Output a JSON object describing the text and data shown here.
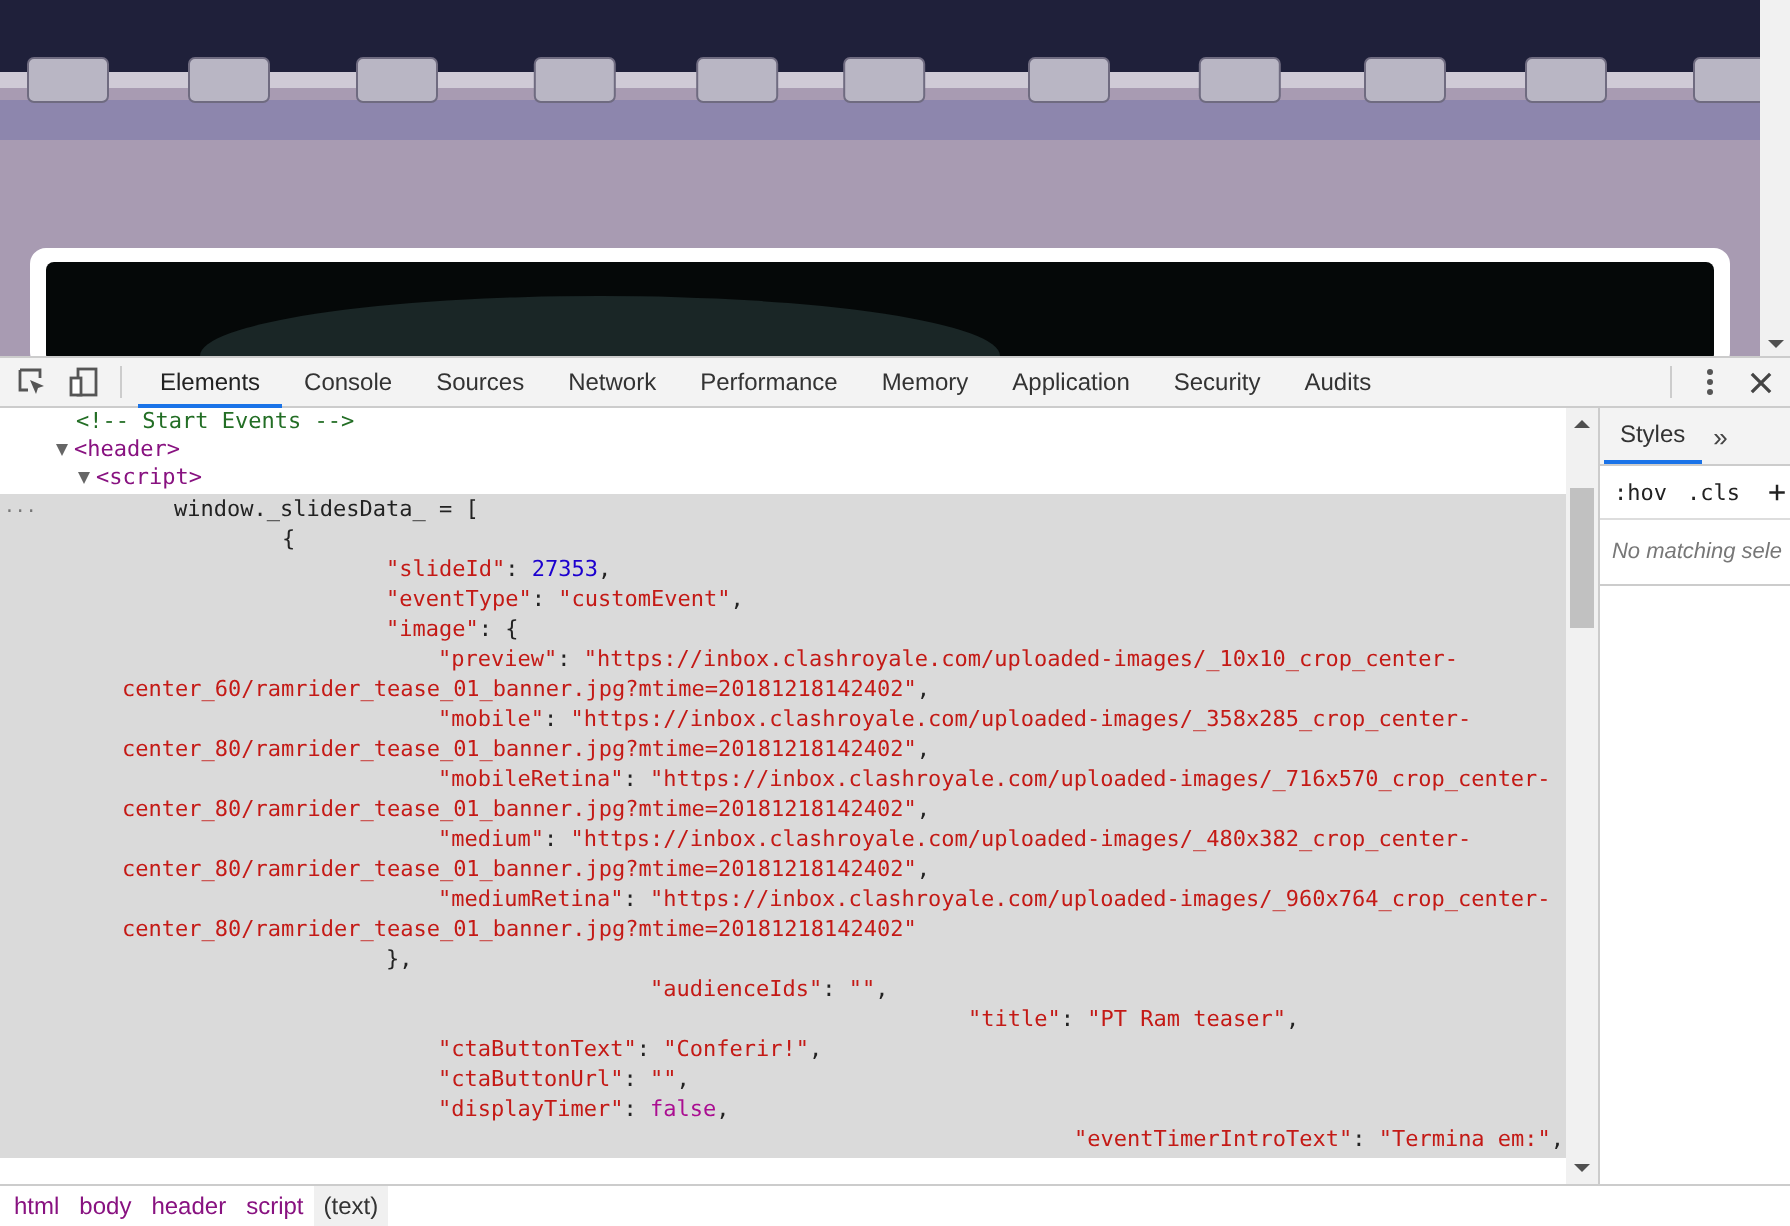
{
  "toolbar": {
    "tabs": [
      {
        "label": "Elements",
        "selected": true
      },
      {
        "label": "Console",
        "selected": false
      },
      {
        "label": "Sources",
        "selected": false
      },
      {
        "label": "Network",
        "selected": false
      },
      {
        "label": "Performance",
        "selected": false
      },
      {
        "label": "Memory",
        "selected": false
      },
      {
        "label": "Application",
        "selected": false
      },
      {
        "label": "Security",
        "selected": false
      },
      {
        "label": "Audits",
        "selected": false
      }
    ]
  },
  "elements": {
    "tree": [
      {
        "kind": "comment",
        "text": "<!-- Start Events -->"
      },
      {
        "kind": "tag",
        "text": "<header>",
        "expanded": true,
        "children": [
          {
            "kind": "tag",
            "text": "<script>",
            "expanded": true
          }
        ]
      }
    ],
    "text_node": {
      "selected": true,
      "gutter": "...",
      "lines": [
        {
          "tokens": [
            {
              "kind": "plain",
              "text": "window._slidesData_ = ["
            }
          ]
        },
        {
          "tokens": [
            {
              "kind": "plain",
              "text": "{"
            }
          ]
        },
        {
          "tokens": [
            {
              "kind": "string",
              "text": "\"slideId\""
            },
            {
              "kind": "plain",
              "text": ": "
            },
            {
              "kind": "number",
              "text": "27353"
            },
            {
              "kind": "plain",
              "text": ","
            }
          ]
        },
        {
          "tokens": [
            {
              "kind": "string",
              "text": "\"eventType\""
            },
            {
              "kind": "plain",
              "text": ": "
            },
            {
              "kind": "string",
              "text": "\"customEvent\""
            },
            {
              "kind": "plain",
              "text": ","
            }
          ]
        },
        {
          "tokens": [
            {
              "kind": "string",
              "text": "\"image\""
            },
            {
              "kind": "plain",
              "text": ": {"
            }
          ]
        },
        {
          "tokens": [
            {
              "kind": "string",
              "text": "\"preview\""
            },
            {
              "kind": "plain",
              "text": ": "
            },
            {
              "kind": "string",
              "text": "\"https://inbox.clashroyale.com/uploaded-images/_10x10_crop_center-"
            }
          ]
        },
        {
          "tokens": [
            {
              "kind": "string",
              "text": "center_60/ramrider_tease_01_banner.jpg?mtime=20181218142402\""
            },
            {
              "kind": "plain",
              "text": ","
            }
          ]
        },
        {
          "tokens": [
            {
              "kind": "string",
              "text": "\"mobile\""
            },
            {
              "kind": "plain",
              "text": ": "
            },
            {
              "kind": "string",
              "text": "\"https://inbox.clashroyale.com/uploaded-images/_358x285_crop_center-"
            }
          ]
        },
        {
          "tokens": [
            {
              "kind": "string",
              "text": "center_80/ramrider_tease_01_banner.jpg?mtime=20181218142402\""
            },
            {
              "kind": "plain",
              "text": ","
            }
          ]
        },
        {
          "tokens": [
            {
              "kind": "string",
              "text": "\"mobileRetina\""
            },
            {
              "kind": "plain",
              "text": ": "
            },
            {
              "kind": "string",
              "text": "\"https://inbox.clashroyale.com/uploaded-images/_716x570_crop_center-"
            }
          ]
        },
        {
          "tokens": [
            {
              "kind": "string",
              "text": "center_80/ramrider_tease_01_banner.jpg?mtime=20181218142402\""
            },
            {
              "kind": "plain",
              "text": ","
            }
          ]
        },
        {
          "tokens": [
            {
              "kind": "string",
              "text": "\"medium\""
            },
            {
              "kind": "plain",
              "text": ": "
            },
            {
              "kind": "string",
              "text": "\"https://inbox.clashroyale.com/uploaded-images/_480x382_crop_center-"
            }
          ]
        },
        {
          "tokens": [
            {
              "kind": "string",
              "text": "center_80/ramrider_tease_01_banner.jpg?mtime=20181218142402\""
            },
            {
              "kind": "plain",
              "text": ","
            }
          ]
        },
        {
          "tokens": [
            {
              "kind": "string",
              "text": "\"mediumRetina\""
            },
            {
              "kind": "plain",
              "text": ": "
            },
            {
              "kind": "string",
              "text": "\"https://inbox.clashroyale.com/uploaded-images/_960x764_crop_center-"
            }
          ]
        },
        {
          "tokens": [
            {
              "kind": "string",
              "text": "center_80/ramrider_tease_01_banner.jpg?mtime=20181218142402\""
            }
          ]
        },
        {
          "tokens": [
            {
              "kind": "plain",
              "text": "},"
            }
          ]
        },
        {
          "tokens": [
            {
              "kind": "string",
              "text": "\"audienceIds\""
            },
            {
              "kind": "plain",
              "text": ": "
            },
            {
              "kind": "string",
              "text": "\"\""
            },
            {
              "kind": "plain",
              "text": ","
            }
          ]
        },
        {
          "tokens": [
            {
              "kind": "string",
              "text": "\"title\""
            },
            {
              "kind": "plain",
              "text": ": "
            },
            {
              "kind": "string",
              "text": "\"PT Ram teaser\""
            },
            {
              "kind": "plain",
              "text": ","
            }
          ]
        },
        {
          "tokens": [
            {
              "kind": "string",
              "text": "\"ctaButtonText\""
            },
            {
              "kind": "plain",
              "text": ": "
            },
            {
              "kind": "string",
              "text": "\"Conferir!\""
            },
            {
              "kind": "plain",
              "text": ","
            }
          ]
        },
        {
          "tokens": [
            {
              "kind": "string",
              "text": "\"ctaButtonUrl\""
            },
            {
              "kind": "plain",
              "text": ": "
            },
            {
              "kind": "string",
              "text": "\"\""
            },
            {
              "kind": "plain",
              "text": ","
            }
          ]
        },
        {
          "tokens": [
            {
              "kind": "string",
              "text": "\"displayTimer\""
            },
            {
              "kind": "plain",
              "text": ": "
            },
            {
              "kind": "keyword",
              "text": "false"
            },
            {
              "kind": "plain",
              "text": ","
            }
          ]
        },
        {
          "tokens": [
            {
              "kind": "string",
              "text": "\"eventTimerIntroText\""
            },
            {
              "kind": "plain",
              "text": ": "
            },
            {
              "kind": "string",
              "text": "\"Termina em:\""
            },
            {
              "kind": "plain",
              "text": ","
            }
          ]
        }
      ]
    }
  },
  "breadcrumbs": [
    {
      "label": "html",
      "selected": false
    },
    {
      "label": "body",
      "selected": false
    },
    {
      "label": "header",
      "selected": false
    },
    {
      "label": "script",
      "selected": false
    },
    {
      "label": "(text)",
      "selected": true
    }
  ],
  "styles_pane": {
    "tabs": [
      {
        "label": "Styles",
        "selected": true
      }
    ],
    "more_tabs": "»",
    "hov": ":hov",
    "cls": ".cls",
    "add": "+",
    "message": "No matching sele"
  }
}
